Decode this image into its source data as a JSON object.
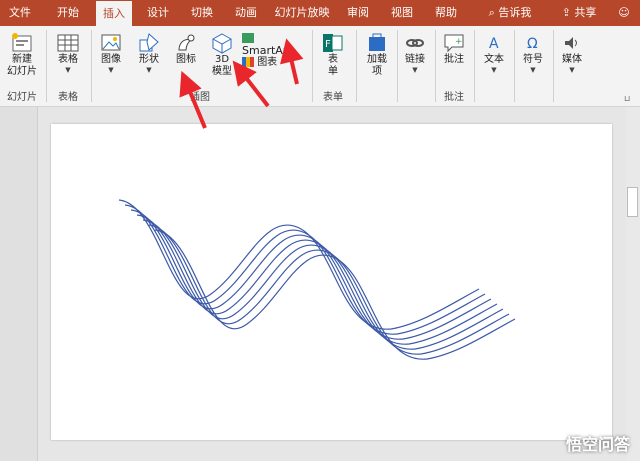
{
  "tabs": [
    "文件",
    "开始",
    "插入",
    "设计",
    "切换",
    "动画",
    "幻灯片放映",
    "审阅",
    "视图",
    "帮助"
  ],
  "tell_me": "告诉我",
  "share": "共享",
  "ribbon": {
    "new_slide": "新建",
    "new_slide2": "幻灯片",
    "table": "表格",
    "image": "图像",
    "shape": "形状",
    "icons": "图标",
    "three_d": "3D",
    "three_d2": "模型",
    "smartart": "SmartArt",
    "chart": "图表",
    "form": "表",
    "form2": "单",
    "addin": "加载",
    "addin2": "项",
    "link": "链接",
    "comment": "批注",
    "text": "文本",
    "symbol": "符号",
    "media": "媒体"
  },
  "groups": {
    "slides": "幻灯片",
    "tables": "表格",
    "illustrations": "插图",
    "forms": "表单",
    "comments": "批注"
  },
  "watermark": "悟空问答",
  "colors": {
    "accent": "#b7472a",
    "curve": "#3d5aa8",
    "arrow": "#e8262c"
  }
}
